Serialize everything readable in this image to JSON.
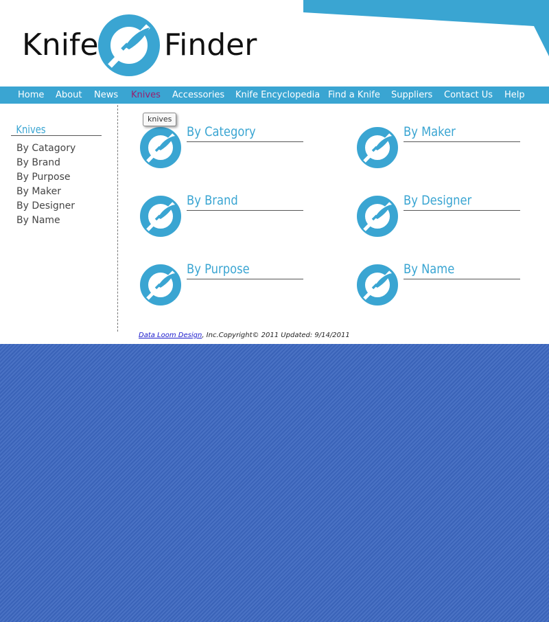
{
  "brand": {
    "word_left": "Knife",
    "word_right": "Finder",
    "accent_color": "#3aa5d2"
  },
  "nav": {
    "items": [
      {
        "label": "Home"
      },
      {
        "label": "About"
      },
      {
        "label": "News"
      },
      {
        "label": "Knives",
        "active": true
      },
      {
        "label": "Accessories"
      },
      {
        "label": "Knife Encyclopedia"
      },
      {
        "label": "Find a Knife"
      },
      {
        "label": "Suppliers"
      },
      {
        "label": "Contact Us"
      },
      {
        "label": "Help"
      }
    ],
    "active_color": "#9a1e6e"
  },
  "sidebar": {
    "heading": "Knives",
    "links": [
      {
        "label": "By Catagory"
      },
      {
        "label": "By Brand"
      },
      {
        "label": "By Purpose"
      },
      {
        "label": "By Maker"
      },
      {
        "label": "By Designer"
      },
      {
        "label": "By Name"
      }
    ]
  },
  "tooltip": {
    "text": "knives"
  },
  "tiles": [
    {
      "title": "By Category",
      "icon": "knife-finder-logo-icon"
    },
    {
      "title": "By Maker",
      "icon": "knife-finder-logo-icon"
    },
    {
      "title": "By Brand",
      "icon": "knife-finder-logo-icon"
    },
    {
      "title": "By Designer",
      "icon": "knife-finder-logo-icon"
    },
    {
      "title": "By Purpose",
      "icon": "knife-finder-logo-icon"
    },
    {
      "title": "By Name",
      "icon": "knife-finder-logo-icon"
    }
  ],
  "footer": {
    "link_text": "Data Loom Design",
    "rest_text": ", Inc.Copyright© 2011 Updated: 9/14/2011"
  },
  "colors": {
    "nav_bar": "#3aa5d2",
    "background": "#3a63b8"
  }
}
